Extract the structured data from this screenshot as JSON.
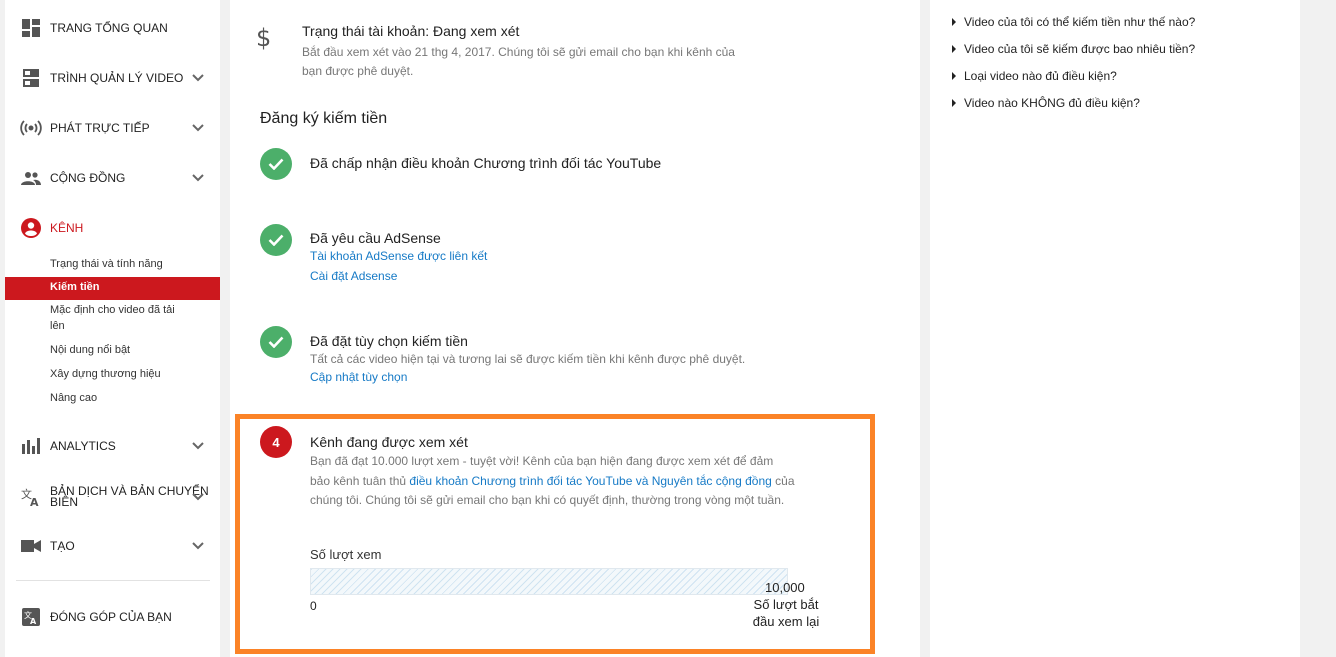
{
  "sidebar": {
    "dashboard": "TRANG TỔNG QUAN",
    "video_manager": "TRÌNH QUẢN LÝ VIDEO",
    "live": "PHÁT TRỰC TIẾP",
    "community": "CỘNG ĐỒNG",
    "channel": "KÊNH",
    "channel_sub": {
      "status": "Trạng thái và tính năng",
      "monetization": "Kiếm tiền",
      "upload_defaults_1": "Mặc định cho video đã tải",
      "upload_defaults_2": "lên",
      "featured": "Nội dung nổi bật",
      "branding": "Xây dựng thương hiệu",
      "advanced": "Nâng cao"
    },
    "analytics": "ANALYTICS",
    "translations_1": "BẢN DỊCH VÀ BẢN CHUYỂN",
    "translations_2": "BIÊN",
    "create": "TẠO",
    "contributions": "ĐÓNG GÓP CỦA BẠN"
  },
  "account_status": {
    "title": "Trạng thái tài khoản: Đang xem xét",
    "desc_1": "Bắt đầu xem xét vào 21 thg 4, 2017. Chúng tôi sẽ gửi email cho bạn khi kênh của",
    "desc_2": "bạn được phê duyệt."
  },
  "monetization": {
    "section_title": "Đăng ký kiếm tiền",
    "step1_title": "Đã chấp nhận điều khoản Chương trình đối tác YouTube",
    "step2_title": "Đã yêu cầu AdSense",
    "step2_link1": "Tài khoản AdSense được liên kết",
    "step2_link2": "Cài đặt Adsense",
    "step3_title": "Đã đặt tùy chọn kiếm tiền",
    "step3_desc": "Tất cả các video hiện tại và tương lai sẽ được kiếm tiền khi kênh được phê duyệt.",
    "step3_link": "Cập nhật tùy chọn",
    "step4_number": "4",
    "step4_title": "Kênh đang được xem xét",
    "step4_desc_a": "Bạn đã đạt 10.000 lượt xem - tuyệt vời! Kênh của bạn hiện đang được xem xét để đảm bảo kênh tuân thủ ",
    "step4_link": "điều khoản Chương trình đối tác YouTube và Nguyên tắc cộng đồng",
    "step4_desc_b": " của chúng tôi. Chúng tôi sẽ gửi email cho bạn khi có quyết định, thường trong vòng một tuần.",
    "views_label": "Số lượt xem",
    "goal_value": "10,000",
    "axis_zero": "0",
    "axis_end": "Số lượt bắt đầu xem lại",
    "progress_fraction": 0.0
  },
  "help": {
    "items": [
      "Video của tôi có thể kiếm tiền như thế nào?",
      "Video của tôi sẽ kiếm được bao nhiêu tiền?",
      "Loại video nào đủ điều kiện?",
      "Video nào KHÔNG đủ điều kiện?"
    ]
  },
  "colors": {
    "accent_red": "#cc181e",
    "check_green": "#4caf6a",
    "link_blue": "#167ac6",
    "highlight_orange": "#fb8327"
  }
}
